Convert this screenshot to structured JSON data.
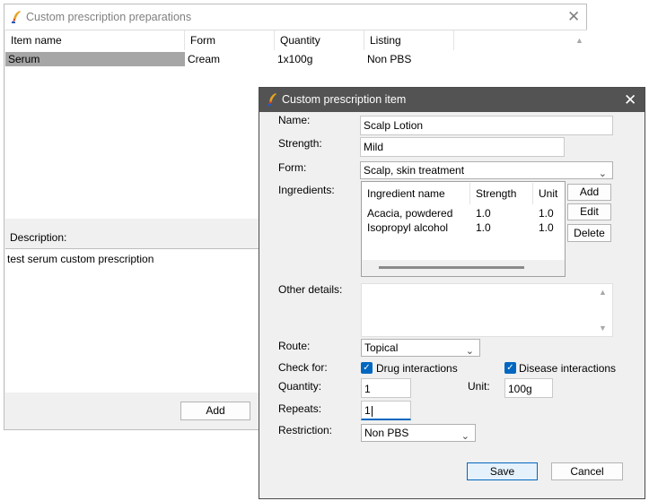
{
  "back_window": {
    "title": "Custom prescription preparations",
    "columns": [
      "Item name",
      "Form",
      "Quantity",
      "Listing"
    ],
    "rows": [
      {
        "item_name": "Serum",
        "form": "Cream",
        "quantity": "1x100g",
        "listing": "Non PBS"
      }
    ],
    "description_label": "Description:",
    "description_text": "test serum custom prescription",
    "add_button": "Add"
  },
  "dialog": {
    "title": "Custom prescription item",
    "name": {
      "label": "Name:",
      "value": "Scalp Lotion"
    },
    "strength": {
      "label": "Strength:",
      "value": "Mild"
    },
    "form": {
      "label": "Form:",
      "value": "Scalp, skin treatment"
    },
    "ingredients": {
      "label": "Ingredients:",
      "columns": [
        "Ingredient name",
        "Strength",
        "Unit"
      ],
      "rows": [
        {
          "name": "Acacia, powdered",
          "strength": "1.0",
          "unit": "1.0"
        },
        {
          "name": "Isopropyl alcohol",
          "strength": "1.0",
          "unit": "1.0"
        }
      ],
      "add_button": "Add",
      "edit_button": "Edit",
      "delete_button": "Delete"
    },
    "other_details": {
      "label": "Other details:",
      "value": ""
    },
    "route": {
      "label": "Route:",
      "value": "Topical"
    },
    "check_for": {
      "label": "Check for:",
      "drug_interactions": {
        "label": "Drug interactions",
        "checked": true
      },
      "disease_interactions": {
        "label": "Disease interactions",
        "checked": true
      }
    },
    "quantity": {
      "label": "Quantity:",
      "value": "1"
    },
    "unit": {
      "label": "Unit:",
      "value": "100g"
    },
    "repeats": {
      "label": "Repeats:",
      "value": "1"
    },
    "restriction": {
      "label": "Restriction:",
      "value": "Non PBS"
    },
    "save_button": "Save",
    "cancel_button": "Cancel"
  },
  "colors": {
    "dialog_titlebar": "#535353",
    "selection": "#a6a6a6",
    "checkbox": "#0067c0",
    "focus_underline": "#0067c0"
  }
}
